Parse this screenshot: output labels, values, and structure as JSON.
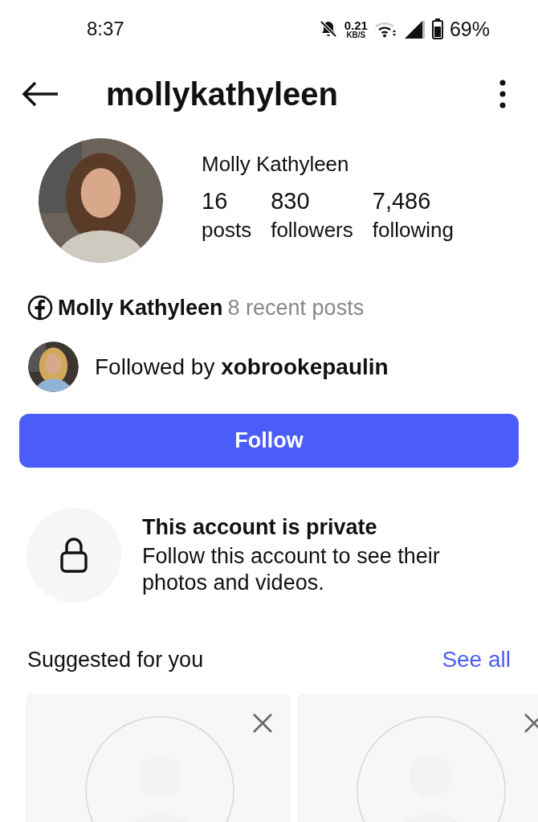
{
  "status_bar": {
    "time": "8:37",
    "speed": "0.21",
    "speed_unit": "KB/S",
    "battery": "69%"
  },
  "header": {
    "username": "mollykathyleen"
  },
  "profile": {
    "name": "Molly Kathyleen",
    "stats": [
      {
        "value": "16",
        "label": "posts"
      },
      {
        "value": "830",
        "label": "followers"
      },
      {
        "value": "7,486",
        "label": "following"
      }
    ]
  },
  "facebook": {
    "name": "Molly Kathyleen",
    "note": "8 recent posts"
  },
  "followed_by": {
    "prefix": "Followed by",
    "user": "xobrookepaulin"
  },
  "follow_button": "Follow",
  "private": {
    "title": "This account is private",
    "text": "Follow this account to see their photos and videos."
  },
  "suggested": {
    "title": "Suggested for you",
    "link": "See all"
  }
}
